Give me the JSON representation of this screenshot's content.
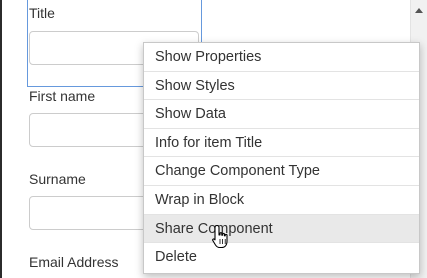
{
  "form": {
    "fields": [
      {
        "label": "Title"
      },
      {
        "label": "First name"
      },
      {
        "label": "Surname"
      },
      {
        "label": "Email Address"
      }
    ]
  },
  "context_menu": {
    "items": [
      {
        "label": "Show Properties"
      },
      {
        "label": "Show Styles"
      },
      {
        "label": "Show Data"
      },
      {
        "label": "Info for item Title"
      },
      {
        "label": "Change Component Type"
      },
      {
        "label": "Wrap in Block"
      },
      {
        "label": "Share Component",
        "hovered": true
      },
      {
        "label": "Delete"
      }
    ]
  },
  "cursor": {
    "icon": "hand-pointer-icon"
  },
  "colors": {
    "selection_outline": "#6699dd",
    "menu_hover": "#e9e9e9"
  }
}
